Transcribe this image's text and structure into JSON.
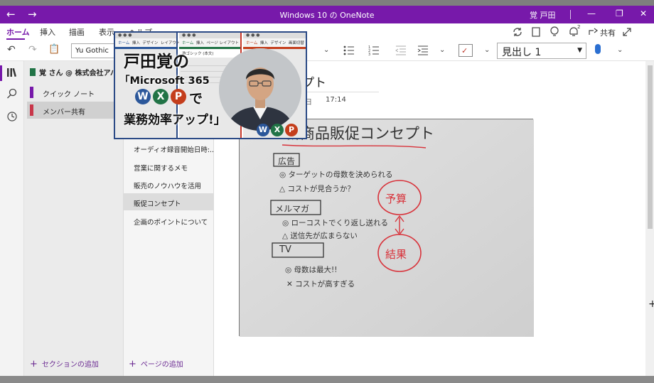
{
  "window": {
    "title": "Windows 10 の OneNote",
    "user": "覚 戸田",
    "back_glyph": "←",
    "forward_glyph": "→",
    "minimize_glyph": "—",
    "restore_glyph": "❐",
    "close_glyph": "✕"
  },
  "ribbon": {
    "tabs": [
      "ホーム",
      "挿入",
      "描画",
      "表示",
      "ヘルプ"
    ],
    "share_label": "共有",
    "notification_count": "2",
    "icons": [
      "sync-icon",
      "lightbulb-icon",
      "bell-icon",
      "share-icon",
      "expand-icon"
    ]
  },
  "toolbar": {
    "font": "Yu Gothic",
    "style": "見出し 1",
    "undo_glyph": "↶",
    "redo_glyph": "↷",
    "clipboard_glyph": "📋"
  },
  "notebook": {
    "name": "覚 さん @ 株式会社アバンザ",
    "sections": [
      {
        "label": "クイック ノート",
        "color": "#7719aa"
      },
      {
        "label": "メンバー共有",
        "color": "#c8374a"
      }
    ],
    "add_section": "セクションの追加"
  },
  "pages": {
    "items": [
      "オーディオ録音開始日時:...",
      "営業に関するメモ",
      "販売のノウハウを活用",
      "販促コンセプト",
      "企画のポイントについて"
    ],
    "selected_index": 3,
    "add_page": "ページの追加"
  },
  "canvas": {
    "page_title": "プト",
    "date": "日",
    "time": "17:14"
  },
  "whiteboard": {
    "heading": "新商品販促コンセプト",
    "blocks": [
      {
        "label": "広告",
        "lines": [
          "◎ ターゲットの母数を決められる",
          "△ コストが見合うか？"
        ]
      },
      {
        "label": "メルマガ",
        "lines": [
          "◎ ローコストでくり返し送れる",
          "△ 送信先が広まらない"
        ]
      },
      {
        "label": "TV",
        "lines": [
          "◎ 母数は最大!!",
          "✕ コストが高すぎる"
        ]
      }
    ],
    "annotations": [
      "予算",
      "結果"
    ]
  },
  "banner": {
    "headline": "戸田覚の",
    "subtitle": "「Microsoft 365",
    "connector": "で",
    "tagline": "業務効率アップ!」",
    "app_letters": [
      "W",
      "X",
      "P"
    ],
    "colors": {
      "word": "#2b579a",
      "excel": "#217346",
      "powerpoint": "#c43e1c",
      "accent": "#7719aa"
    },
    "mini_tabs": {
      "word": [
        "ホーム",
        "挿入",
        "デザイン",
        "レイアウト"
      ],
      "excel": [
        "ホーム",
        "挿入",
        "ページ レイアウト"
      ],
      "powerpoint": [
        "ホーム",
        "挿入",
        "デザイン",
        "画面切替"
      ]
    },
    "mini_font": "游ゴシック (本文)"
  }
}
